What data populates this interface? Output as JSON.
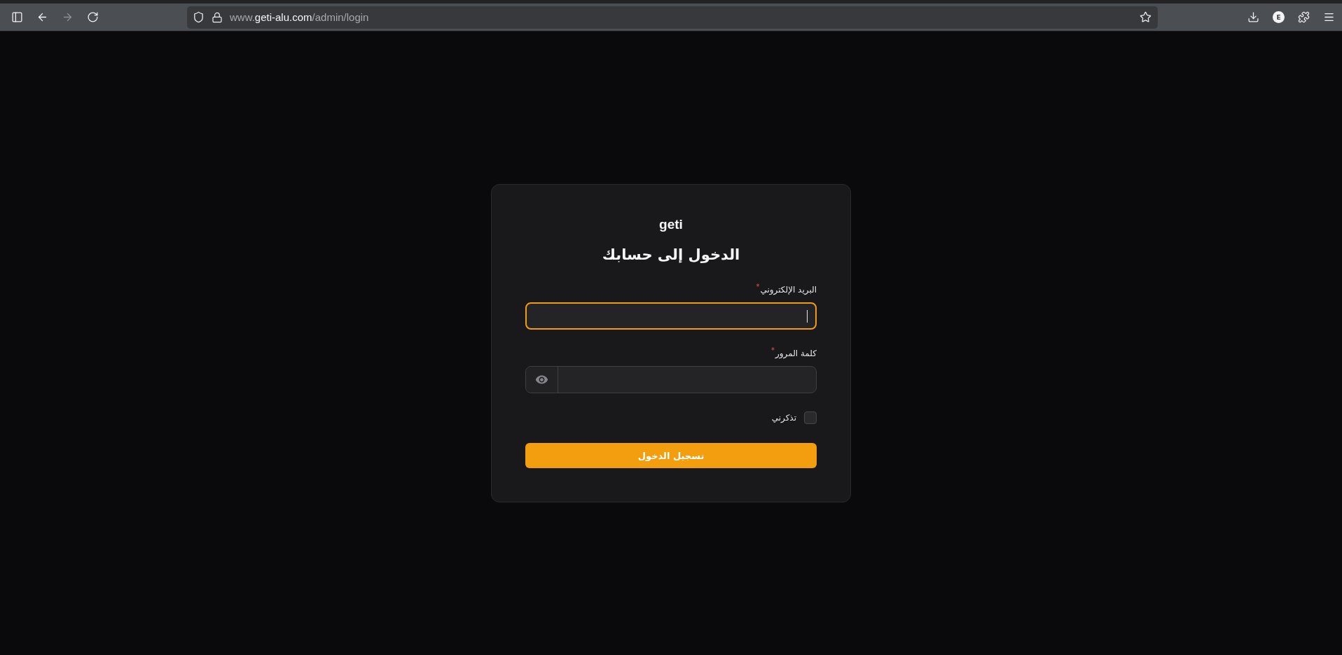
{
  "browser": {
    "nav": [
      {
        "kind": "sidebar",
        "disabled": false
      },
      {
        "kind": "back",
        "disabled": false
      },
      {
        "kind": "forward",
        "disabled": true
      },
      {
        "kind": "reload",
        "disabled": false
      }
    ],
    "url": {
      "prefix": "www.",
      "host": "geti-alu.com",
      "path": "/admin/login"
    },
    "account_initial": "E"
  },
  "login": {
    "brand": "geti",
    "title": "الدخول إلى حسابك",
    "fields": [
      {
        "kind": "email",
        "label": "البريد الإلكتروني",
        "required_mark": "*",
        "focused": true
      },
      {
        "kind": "password",
        "label": "كلمة المرور",
        "required_mark": "*",
        "focused": false
      }
    ],
    "remember": {
      "label": "تذكرني",
      "checked": false
    },
    "submit": "تسجيل الدخول"
  }
}
